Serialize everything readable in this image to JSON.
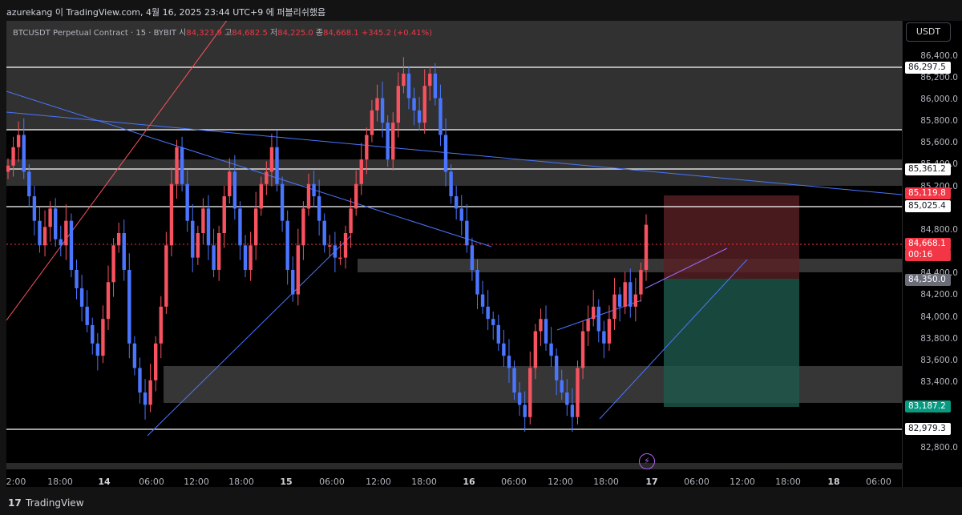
{
  "header": {
    "caption": "azurekang 이 TradingView.com, 4월 16, 2025 23:44 UTC+9 에 퍼블리쉬했음"
  },
  "symbol": {
    "name": "BTCUSDT Perpetual Contract · 15 · BYBIT",
    "open_label": "시",
    "open": "84,323.9",
    "high_label": "고",
    "high": "84,682.5",
    "low_label": "저",
    "low": "84,225.0",
    "close_label": "종",
    "close": "84,668.1",
    "change": "+345.2 (+0.41%)"
  },
  "currency": "USDT",
  "price_ticks": [
    "86,400.0",
    "86,200.0",
    "86,000.0",
    "85,800.0",
    "85,600.0",
    "85,400.0",
    "85,200.0",
    "84,800.0",
    "84,400.0",
    "84,200.0",
    "84,000.0",
    "83,800.0",
    "83,600.0",
    "83,400.0",
    "82,800.0"
  ],
  "price_labels": [
    {
      "text": "86,297.5",
      "style": "white"
    },
    {
      "text": "85,361.2",
      "style": "white"
    },
    {
      "text": "85,119.8",
      "style": "red"
    },
    {
      "text": "85,025.4",
      "style": "white"
    },
    {
      "text": "84,668.1",
      "style": "red"
    },
    {
      "text": "00:16",
      "style": "red"
    },
    {
      "text": "84,350.0",
      "style": "gray"
    },
    {
      "text": "83,187.2",
      "style": "green"
    },
    {
      "text": "82,979.3",
      "style": "white"
    }
  ],
  "time_labels": [
    {
      "text": "2:00",
      "bold": false
    },
    {
      "text": "18:00",
      "bold": false
    },
    {
      "text": "14",
      "bold": true
    },
    {
      "text": "06:00",
      "bold": false
    },
    {
      "text": "12:00",
      "bold": false
    },
    {
      "text": "18:00",
      "bold": false
    },
    {
      "text": "15",
      "bold": true
    },
    {
      "text": "06:00",
      "bold": false
    },
    {
      "text": "12:00",
      "bold": false
    },
    {
      "text": "18:00",
      "bold": false
    },
    {
      "text": "16",
      "bold": true
    },
    {
      "text": "06:00",
      "bold": false
    },
    {
      "text": "12:00",
      "bold": false
    },
    {
      "text": "18:00",
      "bold": false
    },
    {
      "text": "17",
      "bold": true
    },
    {
      "text": "06:00",
      "bold": false
    },
    {
      "text": "12:00",
      "bold": false
    },
    {
      "text": "18:00",
      "bold": false
    },
    {
      "text": "18",
      "bold": true
    },
    {
      "text": "06:00",
      "bold": false
    }
  ],
  "footer": {
    "brand": "TradingView",
    "logo_icon": "tradingview-logo-icon"
  },
  "colors": {
    "up": "#f7525f",
    "down": "#4a76ff",
    "zone": "#5a5a5a",
    "long": "#1e5a4c",
    "stop": "#5a2024"
  },
  "chart_data": {
    "type": "candlestick",
    "ylim": [
      82700,
      86500
    ],
    "close_series": [
      85150,
      85300,
      85400,
      85100,
      84900,
      84700,
      84500,
      84650,
      84800,
      84550,
      84500,
      84700,
      84300,
      84150,
      84000,
      83850,
      83700,
      83600,
      83900,
      84200,
      84500,
      84600,
      84300,
      83700,
      83500,
      83300,
      83200,
      83400,
      83700,
      84000,
      84500,
      85000,
      85300,
      85000,
      84700,
      84400,
      84600,
      84800,
      84500,
      84300,
      84600,
      84900,
      85100,
      84800,
      84500,
      84300,
      84500,
      84800,
      85000,
      85100,
      85300,
      85000,
      84700,
      84300,
      84100,
      84500,
      84800,
      85000,
      84900,
      84700,
      84500,
      84500,
      84400,
      84400,
      84600,
      84800,
      85000,
      85200,
      85400,
      85600,
      85700,
      85500,
      85200,
      85500,
      85800,
      85900,
      85700,
      85600,
      85500,
      85800,
      85900,
      85700,
      85400,
      85100,
      84900,
      84800,
      84700,
      84500,
      84300,
      84100,
      84000,
      83900,
      83850,
      83700,
      83600,
      83500,
      83300,
      83200,
      83100,
      83500,
      83800,
      83900,
      83700,
      83600,
      83400,
      83300,
      83200,
      83100,
      83500,
      83800,
      83900,
      84000,
      83800,
      83700,
      83900,
      84100,
      84000,
      84200,
      84000,
      84100,
      84300,
      84668
    ]
  }
}
